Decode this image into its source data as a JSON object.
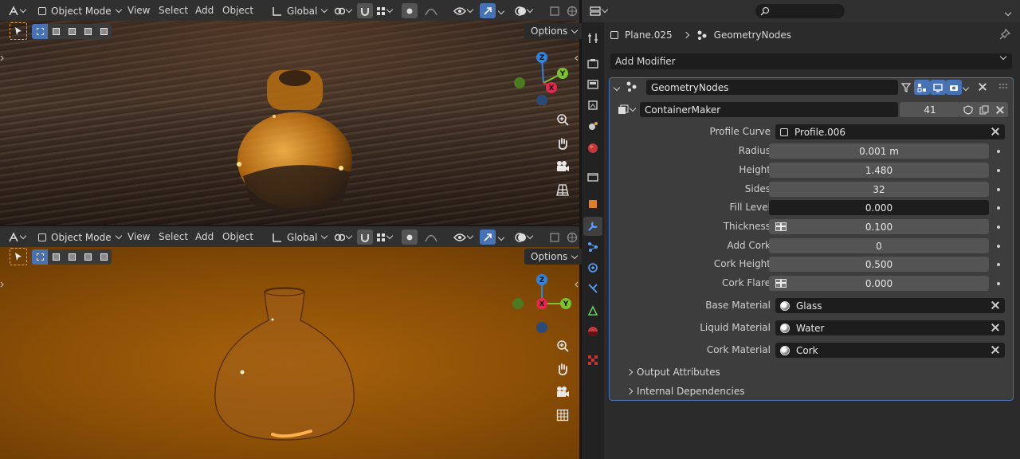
{
  "viewport_top": {
    "header": {
      "mode": "Object Mode",
      "menus": [
        "View",
        "Select",
        "Add",
        "Object"
      ],
      "orientation": "Global"
    },
    "options_label": "Options"
  },
  "viewport_bottom": {
    "header": {
      "mode": "Object Mode",
      "menus": [
        "View",
        "Select",
        "Add",
        "Object"
      ],
      "orientation": "Global"
    },
    "options_label": "Options"
  },
  "gizmo": {
    "x": "X",
    "y": "Y",
    "z": "Z"
  },
  "properties": {
    "breadcrumb": {
      "object": "Plane.025",
      "modifier": "GeometryNodes"
    },
    "add_modifier": "Add Modifier",
    "modifier": {
      "name": "GeometryNodes",
      "node_group": "ContainerMaker",
      "users": "41",
      "inputs": [
        {
          "label": "Profile Curve",
          "value": "Profile.006",
          "kind": "object"
        },
        {
          "label": "Radius",
          "value": "0.001 m",
          "kind": "number"
        },
        {
          "label": "Height",
          "value": "1.480",
          "kind": "number"
        },
        {
          "label": "Sides",
          "value": "32",
          "kind": "number"
        },
        {
          "label": "Fill Level",
          "value": "0.000",
          "kind": "number-dark"
        },
        {
          "label": "Thickness",
          "value": "0.100",
          "kind": "number-flag"
        },
        {
          "label": "Add Cork",
          "value": "0",
          "kind": "number"
        },
        {
          "label": "Cork Height",
          "value": "0.500",
          "kind": "number"
        },
        {
          "label": "Cork Flare",
          "value": "0.000",
          "kind": "number-flag"
        },
        {
          "label": "Base Material",
          "value": "Glass",
          "kind": "material"
        },
        {
          "label": "Liquid Material",
          "value": "Water",
          "kind": "material"
        },
        {
          "label": "Cork Material",
          "value": "Cork",
          "kind": "material"
        }
      ],
      "panels": [
        "Output Attributes",
        "Internal Dependencies"
      ]
    }
  },
  "colors": {
    "accent": "#4772b3",
    "active_outline": "#e0a34a",
    "x_axis": "#e8264e",
    "y_axis": "#7cc22f",
    "z_axis": "#2f84e0"
  }
}
